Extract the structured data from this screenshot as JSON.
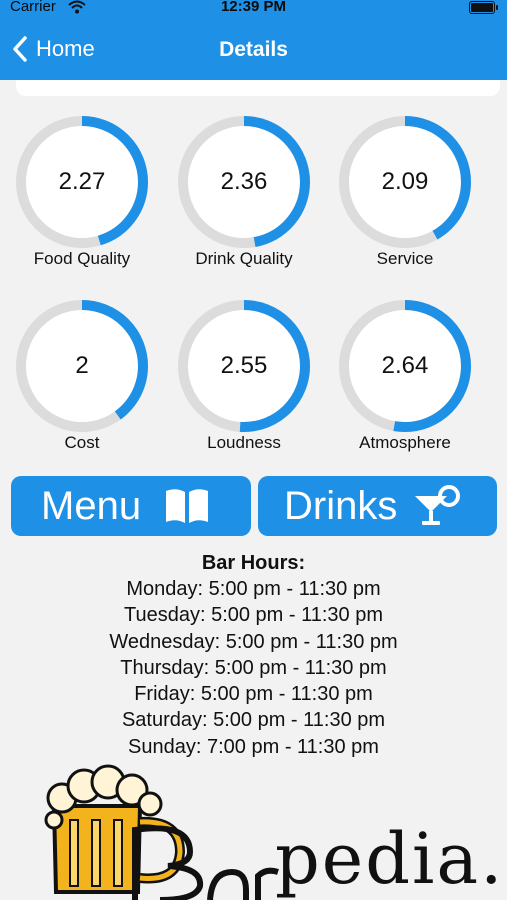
{
  "status": {
    "carrier": "Carrier",
    "time": "12:39 PM"
  },
  "nav": {
    "back_label": "Home",
    "title": "Details"
  },
  "ratings": [
    {
      "label": "Food Quality",
      "value": "2.27",
      "fraction": 0.454
    },
    {
      "label": "Drink Quality",
      "value": "2.36",
      "fraction": 0.472
    },
    {
      "label": "Service",
      "value": "2.09",
      "fraction": 0.418
    },
    {
      "label": "Cost",
      "value": "2",
      "fraction": 0.4
    },
    {
      "label": "Loudness",
      "value": "2.55",
      "fraction": 0.51
    },
    {
      "label": "Atmosphere",
      "value": "2.64",
      "fraction": 0.528
    }
  ],
  "buttons": {
    "menu_label": "Menu",
    "drinks_label": "Drinks"
  },
  "hours": {
    "title": "Bar Hours:",
    "days": [
      "Monday: 5:00 pm - 11:30 pm",
      "Tuesday: 5:00 pm - 11:30 pm",
      "Wednesday: 5:00 pm - 11:30 pm",
      "Thursday: 5:00 pm - 11:30 pm",
      "Friday: 5:00 pm - 11:30 pm",
      "Saturday: 5:00 pm - 11:30 pm",
      "Sunday: 7:00 pm - 11:30 pm"
    ]
  },
  "logo": {
    "text": "pedia."
  },
  "colors": {
    "accent": "#1e90e6",
    "track": "#dcdcdc",
    "background": "#f2f2f2"
  }
}
